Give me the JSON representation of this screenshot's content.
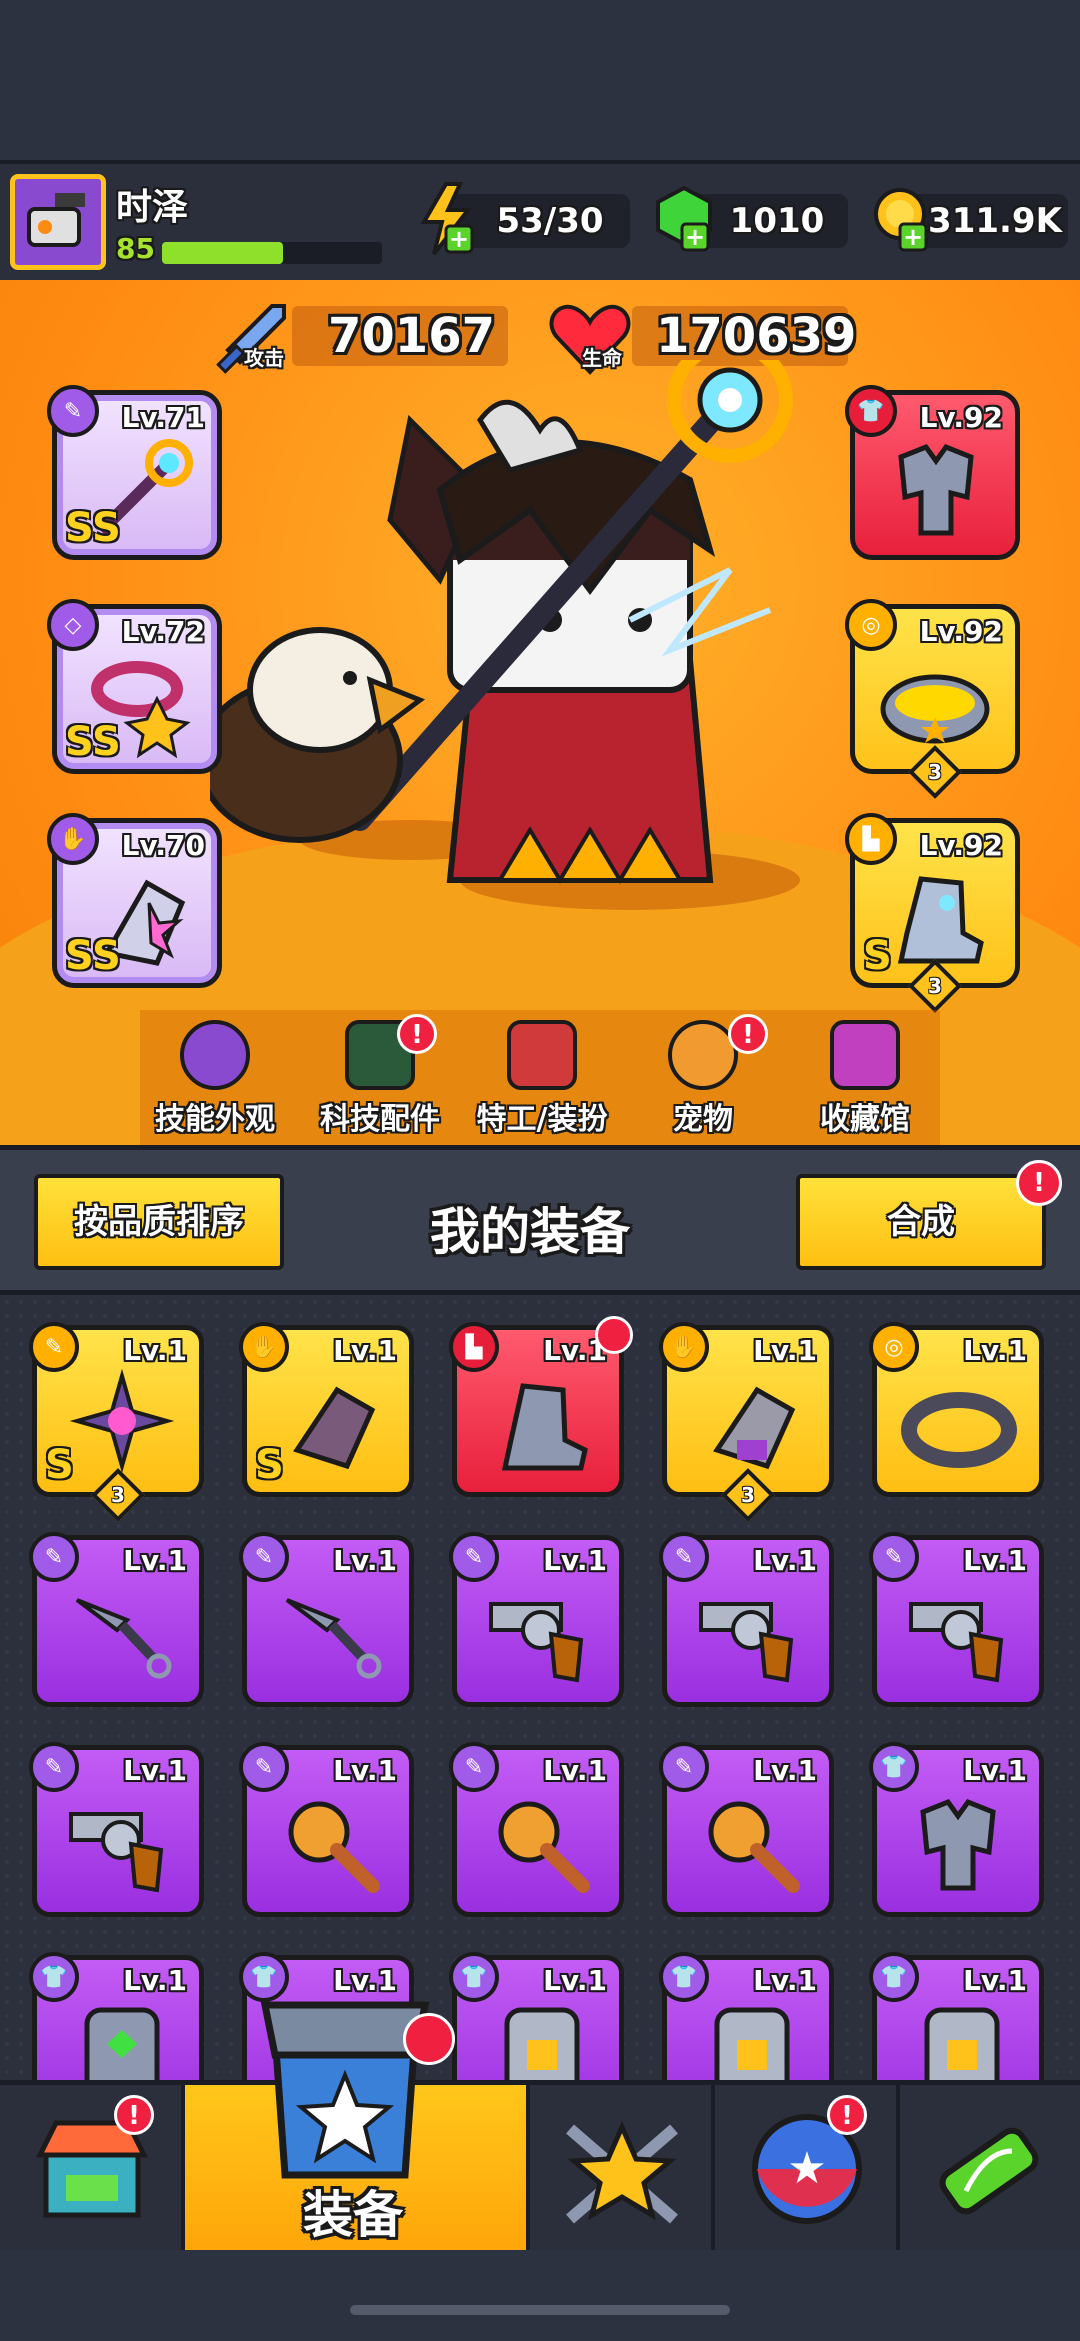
{
  "player": {
    "name": "时泽",
    "level": "85",
    "xp_progress": 0.55
  },
  "resources": {
    "energy": "53/30",
    "gems": "1010",
    "gold": "311.9K"
  },
  "stats": {
    "attack_label": "攻击",
    "attack_value": "70167",
    "hp_label": "生命",
    "hp_value": "170639"
  },
  "equipped_left": [
    {
      "level": "Lv.71",
      "grade": "SS"
    },
    {
      "level": "Lv.72",
      "grade": "SS"
    },
    {
      "level": "Lv.70",
      "grade": "SS"
    }
  ],
  "equipped_right": [
    {
      "level": "Lv.92",
      "stars": ""
    },
    {
      "level": "Lv.92",
      "stars": "3"
    },
    {
      "level": "Lv.92",
      "grade": "S",
      "stars": "3"
    }
  ],
  "hero_menu": [
    {
      "label": "技能外观",
      "alert": false
    },
    {
      "label": "科技配件",
      "alert": true
    },
    {
      "label": "特工/装扮",
      "alert": false
    },
    {
      "label": "宠物",
      "alert": true
    },
    {
      "label": "收藏馆",
      "alert": false
    }
  ],
  "inventory": {
    "title": "我的装备",
    "sort_button": "按品质排序",
    "merge_button": "合成",
    "alert_mark": "!",
    "items": [
      {
        "level": "Lv.1",
        "grade": "S",
        "stars": "3"
      },
      {
        "level": "Lv.1",
        "grade": "S",
        "stars": ""
      },
      {
        "level": "Lv.1",
        "grade": "",
        "stars": ""
      },
      {
        "level": "Lv.1",
        "grade": "",
        "stars": "3"
      },
      {
        "level": "Lv.1",
        "grade": "",
        "stars": ""
      },
      {
        "level": "Lv.1"
      },
      {
        "level": "Lv.1"
      },
      {
        "level": "Lv.1"
      },
      {
        "level": "Lv.1"
      },
      {
        "level": "Lv.1"
      },
      {
        "level": "Lv.1"
      },
      {
        "level": "Lv.1"
      },
      {
        "level": "Lv.1"
      },
      {
        "level": "Lv.1"
      },
      {
        "level": "Lv.1"
      },
      {
        "level": "Lv.1"
      },
      {
        "level": "Lv.1"
      },
      {
        "level": "Lv.1"
      },
      {
        "level": "Lv.1"
      },
      {
        "level": "Lv.1"
      }
    ]
  },
  "bottom_nav": {
    "active_label": "装备"
  }
}
